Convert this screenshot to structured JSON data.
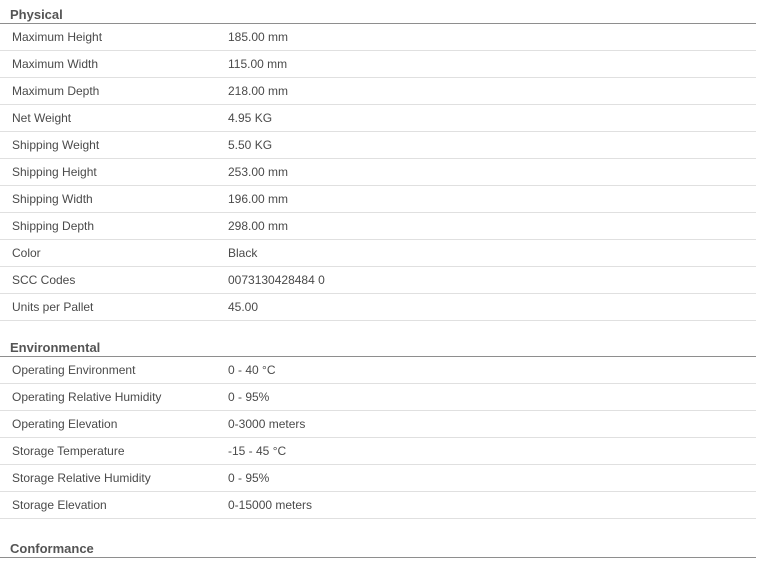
{
  "sections": [
    {
      "title": "Physical",
      "rows": [
        {
          "label": "Maximum Height",
          "value": "185.00 mm"
        },
        {
          "label": "Maximum Width",
          "value": "115.00 mm"
        },
        {
          "label": "Maximum Depth",
          "value": "218.00 mm"
        },
        {
          "label": "Net Weight",
          "value": "4.95 KG"
        },
        {
          "label": "Shipping Weight",
          "value": "5.50 KG"
        },
        {
          "label": "Shipping Height",
          "value": "253.00 mm"
        },
        {
          "label": "Shipping Width",
          "value": "196.00 mm"
        },
        {
          "label": "Shipping Depth",
          "value": "298.00 mm"
        },
        {
          "label": "Color",
          "value": "Black"
        },
        {
          "label": "SCC Codes",
          "value": "0073130428484 0"
        },
        {
          "label": "Units per Pallet",
          "value": "45.00"
        }
      ]
    },
    {
      "title": "Environmental",
      "rows": [
        {
          "label": "Operating Environment",
          "value": "0 - 40 °C"
        },
        {
          "label": "Operating Relative Humidity",
          "value": "0 - 95%"
        },
        {
          "label": "Operating Elevation",
          "value": "0-3000 meters"
        },
        {
          "label": "Storage Temperature",
          "value": "-15 - 45 °C"
        },
        {
          "label": "Storage Relative Humidity",
          "value": "0 - 95%"
        },
        {
          "label": "Storage Elevation",
          "value": "0-15000 meters"
        }
      ]
    },
    {
      "title": "Conformance",
      "rows": []
    }
  ]
}
